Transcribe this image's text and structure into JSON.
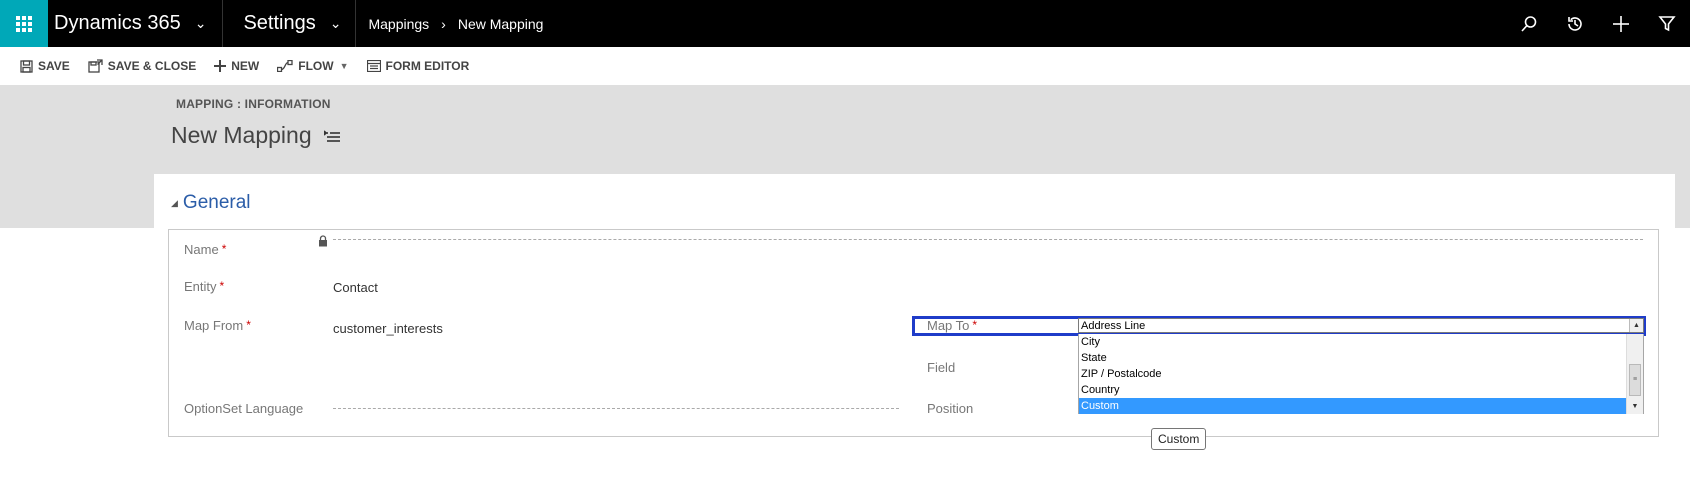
{
  "topnav": {
    "app_name": "Dynamics 365",
    "area": "Settings",
    "breadcrumb": [
      "Mappings",
      "New Mapping"
    ],
    "icons": [
      "search-icon",
      "history-icon",
      "plus-icon",
      "filter-icon"
    ]
  },
  "commands": [
    {
      "label": "SAVE",
      "icon": "save-icon"
    },
    {
      "label": "SAVE & CLOSE",
      "icon": "save-close-icon"
    },
    {
      "label": "NEW",
      "icon": "plus-icon"
    },
    {
      "label": "FLOW",
      "icon": "flow-icon"
    },
    {
      "label": "FORM EDITOR",
      "icon": "form-editor-icon"
    }
  ],
  "header": {
    "entity_form": "MAPPING : INFORMATION",
    "record_title": "New Mapping"
  },
  "section": {
    "title": "General",
    "fields": {
      "name": {
        "label": "Name",
        "value": ""
      },
      "entity": {
        "label": "Entity",
        "value": "Contact"
      },
      "map_from": {
        "label": "Map From",
        "value": "customer_interests"
      },
      "optionset_language": {
        "label": "OptionSet Language",
        "value": ""
      },
      "map_to": {
        "label": "Map To",
        "value": "Address Line"
      },
      "field": {
        "label": "Field",
        "value": ""
      },
      "position": {
        "label": "Position",
        "value": ""
      }
    },
    "dropdown_options": [
      "City",
      "State",
      "ZIP / Postalcode",
      "Country",
      "Custom"
    ],
    "selected_option": "Custom",
    "tooltip": "Custom"
  },
  "colors": {
    "nav_bg": "#000000",
    "waffle_bg": "#00a8b8",
    "section_title": "#2b5da8",
    "focus_border": "#1f3cc9",
    "selection": "#3399ff",
    "required": "#cc0000"
  }
}
